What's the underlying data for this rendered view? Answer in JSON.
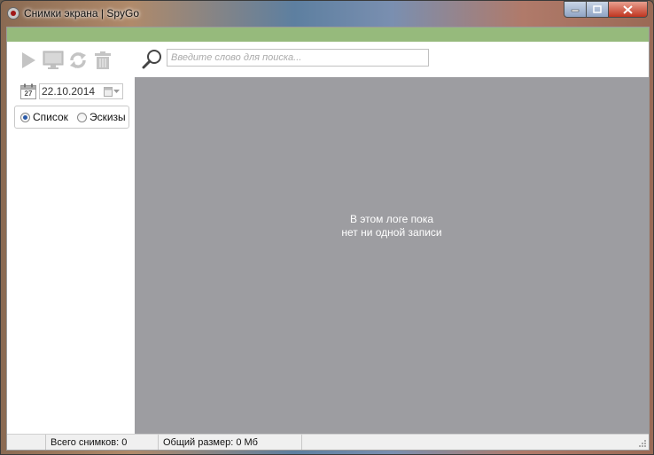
{
  "window": {
    "title": "Снимки экрана | SpyGo"
  },
  "toolbar": {
    "buttons": [
      {
        "name": "play-icon"
      },
      {
        "name": "monitor-icon"
      },
      {
        "name": "refresh-icon"
      },
      {
        "name": "trash-icon"
      }
    ]
  },
  "date": {
    "calendar_day": "27",
    "value": "22.10.2014"
  },
  "view": {
    "list_label": "Список",
    "thumbs_label": "Эскизы",
    "selected": "list"
  },
  "search": {
    "placeholder": "Введите слово для поиска..."
  },
  "main": {
    "empty_line1": "В этом логе пока",
    "empty_line2": "нет ни одной записи"
  },
  "status": {
    "total": "Всего снимков: 0",
    "size": "Общий размер: 0 Мб"
  },
  "colors": {
    "accent_bar": "#96ba7c",
    "content_bg": "#9d9da1"
  }
}
